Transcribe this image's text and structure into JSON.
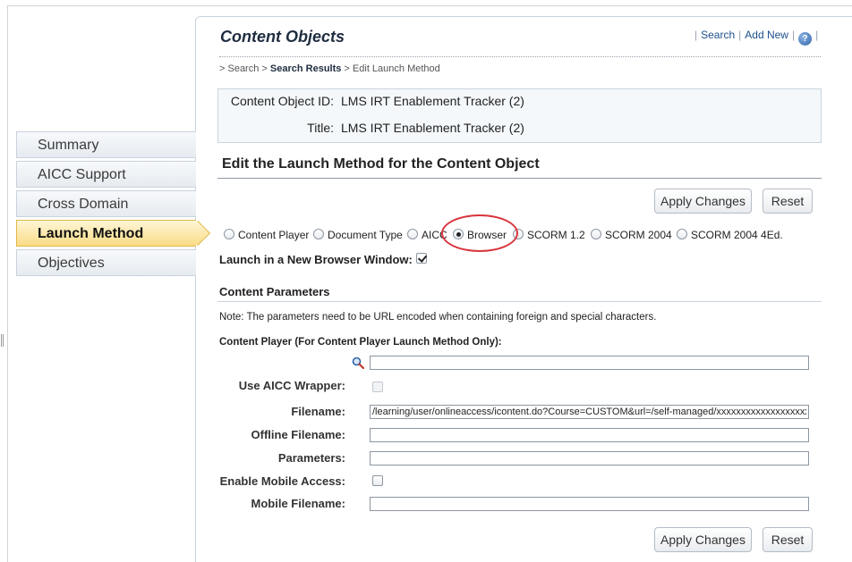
{
  "header": {
    "title": "Content Objects",
    "links": {
      "search": "Search",
      "add_new": "Add New",
      "help_glyph": "?"
    },
    "separator": "|"
  },
  "breadcrumb": {
    "prefix": "> ",
    "search": "Search",
    "sep": " > ",
    "results": "Search Results",
    "current": "Edit Launch Method"
  },
  "sidebar": {
    "items": [
      {
        "label": "Summary"
      },
      {
        "label": "AICC Support"
      },
      {
        "label": "Cross Domain"
      },
      {
        "label": "Launch Method",
        "active": true
      },
      {
        "label": "Objectives"
      }
    ]
  },
  "info": {
    "id_label": "Content Object ID:",
    "id_value": "LMS IRT Enablement Tracker (2)",
    "title_label": "Title:",
    "title_value": "LMS IRT Enablement Tracker (2)"
  },
  "section": {
    "title": "Edit the Launch Method for the Content Object",
    "apply_label": "Apply Changes",
    "reset_label": "Reset"
  },
  "launch_methods": [
    {
      "label": "Content Player",
      "selected": false
    },
    {
      "label": "Document Type",
      "selected": false
    },
    {
      "label": "AICC",
      "selected": false
    },
    {
      "label": "Browser",
      "selected": true
    },
    {
      "label": "SCORM 1.2",
      "selected": false
    },
    {
      "label": "SCORM 2004",
      "selected": false
    },
    {
      "label": "SCORM 2004 4Ed.",
      "selected": false
    }
  ],
  "new_window": {
    "label": "Launch in a New Browser Window:",
    "checked": true
  },
  "params": {
    "title": "Content Parameters",
    "note": "Note: The parameters need to be URL encoded when containing foreign and special characters.",
    "content_player_label": "Content Player (For Content Player Launch Method Only):",
    "content_player_value": "",
    "aicc_wrapper_label": "Use AICC Wrapper:",
    "filename_label": "Filename:",
    "filename_value": "/learning/user/onlineaccess/icontent.do?Course=CUSTOM&url=/self-managed/xxxxxxxxxxxxxxxxxxxx",
    "offline_label": "Offline Filename:",
    "offline_value": "",
    "parameters_label": "Parameters:",
    "parameters_value": "",
    "mobile_access_label": "Enable Mobile Access:",
    "mobile_filename_label": "Mobile Filename:",
    "mobile_filename_value": ""
  },
  "colors": {
    "accent": "#1d4f8c",
    "active_tab": "#f9dc86",
    "highlight": "#d9363e"
  }
}
